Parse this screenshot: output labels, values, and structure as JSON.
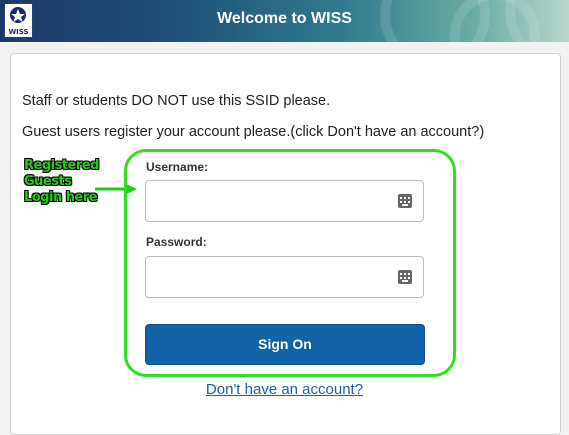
{
  "header": {
    "title": "Welcome to WISS",
    "logo_text": "WISS",
    "colors": {
      "start": "#1b3b66",
      "end": "#b9d6cc"
    }
  },
  "notice": {
    "line1": "Staff or students DO NOT use this SSID please.",
    "line2": "Guest users register your account please.(click Don't have an account?)"
  },
  "annotation": {
    "lines": [
      "Registered",
      "Guests",
      "Login here"
    ],
    "color": "#22cc11"
  },
  "form": {
    "username_label": "Username:",
    "username_value": "",
    "password_label": "Password:",
    "password_value": "",
    "field_icon": "keyboard-icon",
    "submit_label": "Sign On",
    "submit_color": "#1262a8",
    "register_link": "Don't have an account?"
  }
}
